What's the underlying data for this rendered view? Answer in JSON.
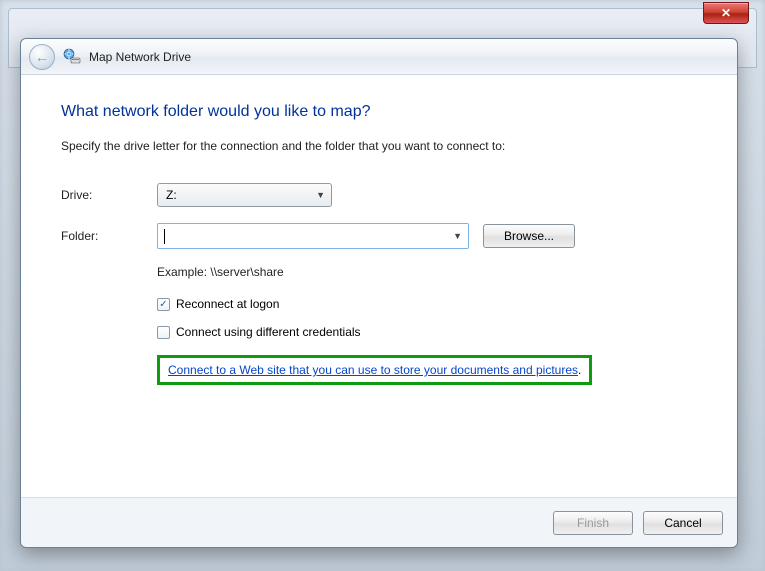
{
  "outer_window": {
    "close_label": "✕"
  },
  "titlebar": {
    "title": "Map Network Drive",
    "back_arrow": "←"
  },
  "main": {
    "heading": "What network folder would you like to map?",
    "instruction": "Specify the drive letter for the connection and the folder that you want to connect to:",
    "drive_label": "Drive:",
    "drive_value": "Z:",
    "folder_label": "Folder:",
    "folder_value": "",
    "browse_label": "Browse...",
    "example_text": "Example: \\\\server\\share",
    "reconnect_label": "Reconnect at logon",
    "credentials_label": "Connect using different credentials",
    "website_link_text": "Connect to a Web site that you can use to store your documents and pictures",
    "period": "."
  },
  "footer": {
    "finish_label": "Finish",
    "cancel_label": "Cancel"
  },
  "checkbox_states": {
    "reconnect_checked": true,
    "credentials_checked": false
  }
}
